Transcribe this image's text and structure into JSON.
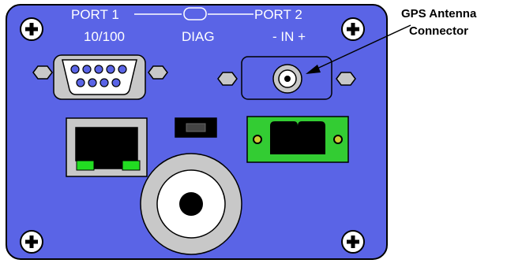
{
  "labels": {
    "port1": "PORT 1",
    "port1_speed": "10/100",
    "diag": "DIAG",
    "port2": "PORT 2",
    "port2_polarity": "- IN +"
  },
  "callout": {
    "line1": "GPS Antenna",
    "line2": "Connector"
  },
  "colors": {
    "panel": "#5a64e6",
    "panel_border": "#000000",
    "connector_gray": "#c8c8c8",
    "terminal_green": "#33cc33",
    "led_green": "#22dd22"
  }
}
